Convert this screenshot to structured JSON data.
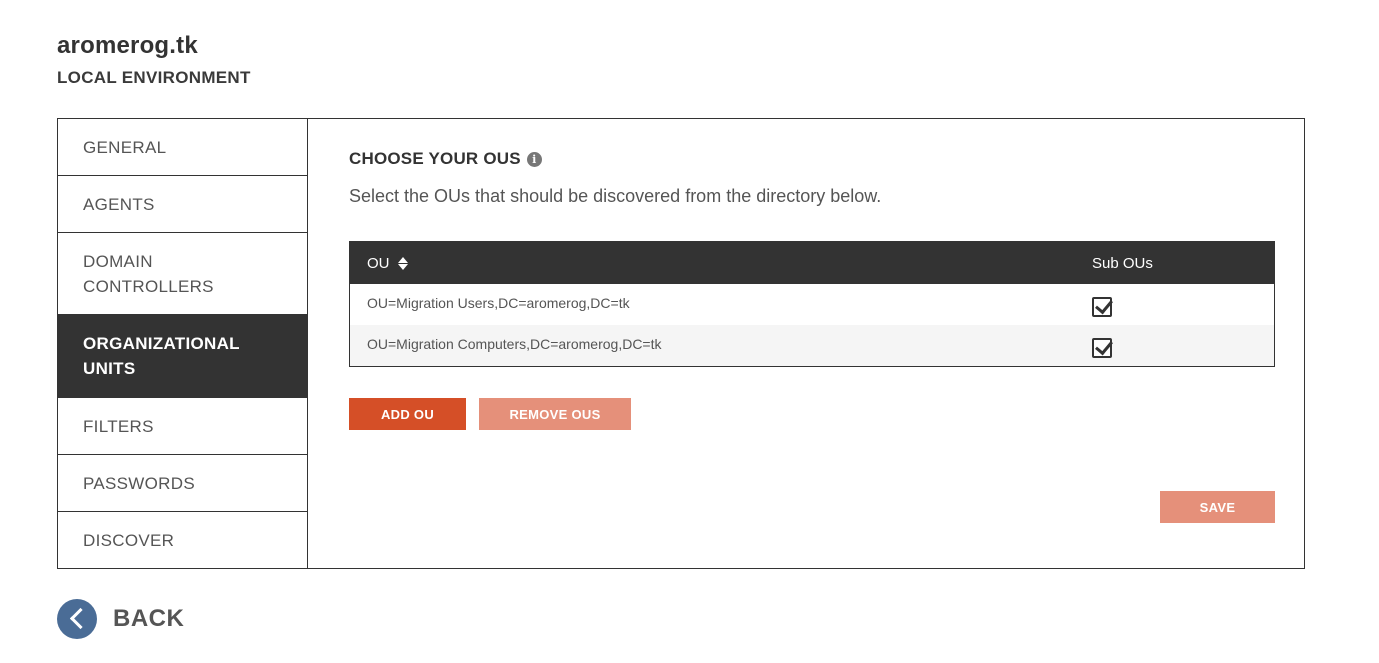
{
  "header": {
    "title": "aromerog.tk",
    "subtitle": "LOCAL ENVIRONMENT"
  },
  "sidebar": {
    "items": [
      {
        "label": "GENERAL",
        "active": false
      },
      {
        "label": "AGENTS",
        "active": false
      },
      {
        "label": "DOMAIN\nCONTROLLERS",
        "active": false
      },
      {
        "label": "ORGANIZATIONAL\nUNITS",
        "active": true
      },
      {
        "label": "FILTERS",
        "active": false
      },
      {
        "label": "PASSWORDS",
        "active": false
      },
      {
        "label": "DISCOVER",
        "active": false
      }
    ]
  },
  "main": {
    "section_title": "CHOOSE YOUR OUS",
    "info_icon": "info-circle-icon",
    "description": "Select the OUs that should be discovered from the directory below.",
    "table": {
      "columns": [
        "OU",
        "Sub OUs"
      ],
      "sort_icon": "sort-icon",
      "rows": [
        {
          "ou": "OU=Migration Users,DC=aromerog,DC=tk",
          "sub_ous": true
        },
        {
          "ou": "OU=Migration Computers,DC=aromerog,DC=tk",
          "sub_ous": true
        }
      ]
    },
    "buttons": {
      "add": "ADD OU",
      "remove": "REMOVE OUS",
      "save": "SAVE"
    }
  },
  "footer": {
    "back_label": "BACK",
    "back_icon": "chevron-left-icon"
  },
  "colors": {
    "dark": "#333333",
    "primary_button": "#d54f27",
    "disabled_button": "#e5907a",
    "back_circle": "#4a6c96"
  }
}
